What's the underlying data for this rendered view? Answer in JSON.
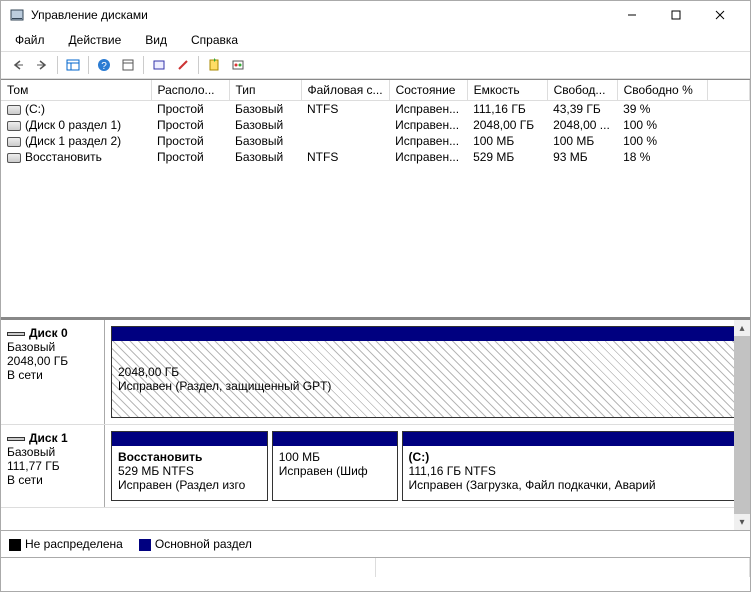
{
  "window": {
    "title": "Управление дисками"
  },
  "menu": {
    "file": "Файл",
    "action": "Действие",
    "view": "Вид",
    "help": "Справка"
  },
  "table": {
    "headers": [
      "Том",
      "Располо...",
      "Тип",
      "Файловая с...",
      "Состояние",
      "Емкость",
      "Свобод...",
      "Свободно %"
    ],
    "rows": [
      {
        "name": "(C:)",
        "layout": "Простой",
        "type": "Базовый",
        "fs": "NTFS",
        "status": "Исправен...",
        "capacity": "111,16 ГБ",
        "free": "43,39 ГБ",
        "pct": "39 %"
      },
      {
        "name": "(Диск 0 раздел 1)",
        "layout": "Простой",
        "type": "Базовый",
        "fs": "",
        "status": "Исправен...",
        "capacity": "2048,00 ГБ",
        "free": "2048,00 ...",
        "pct": "100 %"
      },
      {
        "name": "(Диск 1 раздел 2)",
        "layout": "Простой",
        "type": "Базовый",
        "fs": "",
        "status": "Исправен...",
        "capacity": "100 МБ",
        "free": "100 МБ",
        "pct": "100 %"
      },
      {
        "name": "Восстановить",
        "layout": "Простой",
        "type": "Базовый",
        "fs": "NTFS",
        "status": "Исправен...",
        "capacity": "529 МБ",
        "free": "93 МБ",
        "pct": "18 %"
      }
    ]
  },
  "disks": [
    {
      "name": "Диск 0",
      "type": "Базовый",
      "size": "2048,00 ГБ",
      "status": "В сети",
      "partitions": [
        {
          "title": "",
          "size": "2048,00 ГБ",
          "status": "Исправен (Раздел, защищенный GPT)",
          "style": "hatch",
          "flex": 1
        }
      ]
    },
    {
      "name": "Диск 1",
      "type": "Базовый",
      "size": "111,77 ГБ",
      "status": "В сети",
      "partitions": [
        {
          "title": "Восстановить",
          "size": "529 МБ NTFS",
          "status": "Исправен (Раздел изго",
          "style": "primary",
          "flex": 25
        },
        {
          "title": "",
          "size": "100 МБ",
          "status": "Исправен (Шиф",
          "style": "primary",
          "flex": 20
        },
        {
          "title": "(C:)",
          "size": "111,16 ГБ NTFS",
          "status": "Исправен (Загрузка, Файл подкачки, Аварий",
          "style": "primary",
          "flex": 55
        }
      ]
    }
  ],
  "legend": {
    "unallocated": "Не распределена",
    "primary": "Основной раздел"
  },
  "colors": {
    "primary": "#000080",
    "unallocated": "#000000"
  }
}
